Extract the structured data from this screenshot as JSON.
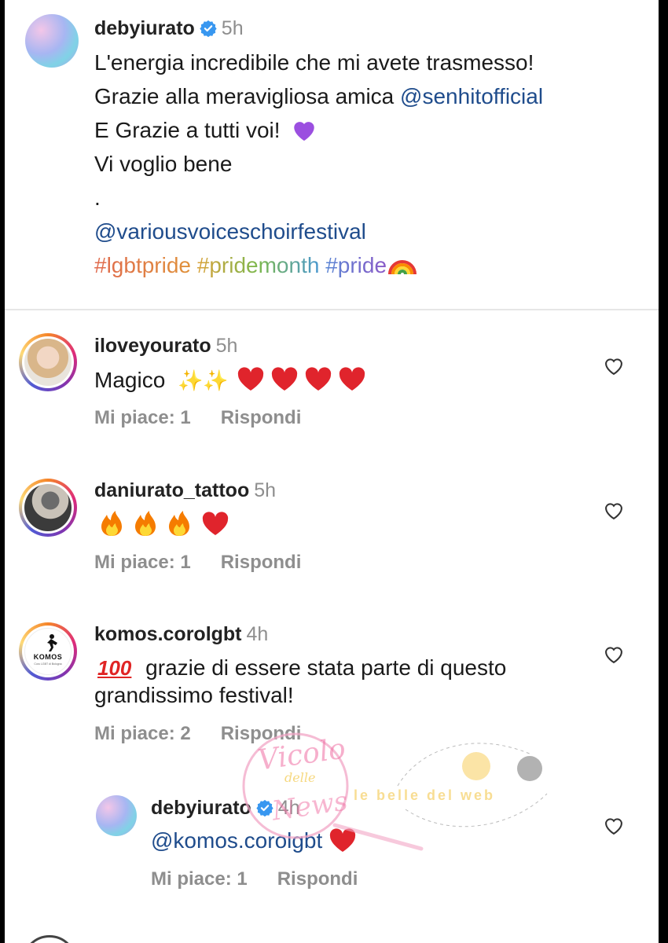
{
  "post": {
    "username": "debyiurato",
    "time": "5h",
    "caption_lines": [
      "L'energia incredibile che mi avete trasmesso!",
      "Grazie alla meravigliosa amica",
      "E Grazie a tutti voi!",
      "Vi voglio bene",
      "."
    ],
    "mention_1": "@senhitofficial",
    "mention_2": "@variousvoiceschoirfestival",
    "hashtags": [
      "#lgbtpride",
      "#pridemonth",
      "#pride"
    ],
    "hashtag_colors": [
      "#e0704c",
      "#d67a3a",
      "#c9a23a",
      "#6fb24f",
      "#4a90d0",
      "#8a5ac8"
    ]
  },
  "comments": [
    {
      "username": "iloveyourato",
      "time": "5h",
      "text": "Magico",
      "likes_label": "Mi piace: 1",
      "reply_label": "Rispondi"
    },
    {
      "username": "daniurato_tattoo",
      "time": "5h",
      "text": "",
      "likes_label": "Mi piace: 1",
      "reply_label": "Rispondi"
    },
    {
      "username": "komos.corolgbt",
      "time": "4h",
      "text_line1": "grazie di essere stata parte di questo",
      "text_line2": "grandissimo festival!",
      "likes_label": "Mi piace: 2",
      "reply_label": "Rispondi",
      "avatar_logo": "KOMOS",
      "avatar_sub": "Coro LGBT di Bologna"
    },
    {
      "username": "debyiurato",
      "time": "4h",
      "mention": "@komos.corolgbt",
      "likes_label": "Mi piace: 1",
      "reply_label": "Rispondi"
    }
  ],
  "watermark": {
    "line1": "Vicolo",
    "line2": "delle",
    "line3": "News",
    "tagline": "le belle del web"
  },
  "colors": {
    "mention": "#1f4c8c",
    "meta": "#8e8e8e",
    "heart": "#e0242c",
    "verified": "#3897f0"
  },
  "icons": [
    "verified-badge-icon",
    "heart-outline-icon",
    "sparkles-icon",
    "red-heart-icon",
    "fire-icon",
    "purple-heart-icon",
    "rainbow-icon",
    "hundred-points-icon"
  ]
}
